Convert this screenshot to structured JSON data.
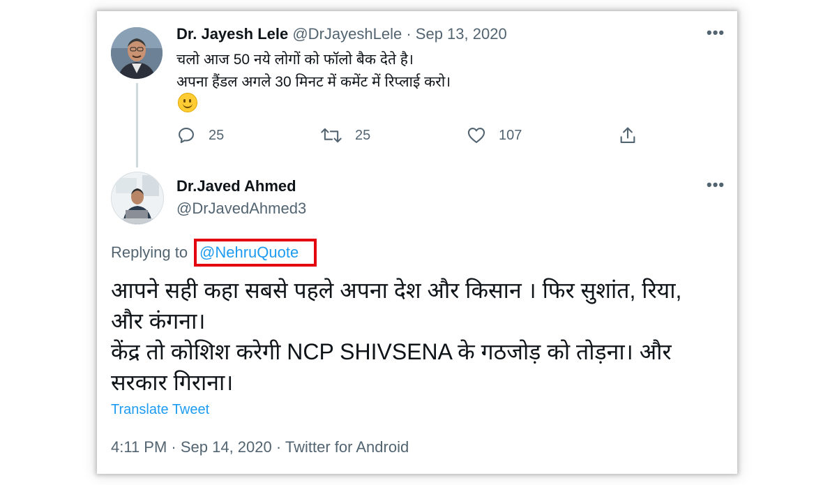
{
  "tweet1": {
    "name": "Dr. Jayesh Lele",
    "handle": "@DrJayeshLele",
    "date": "Sep 13, 2020",
    "lines": [
      "चलो आज 50 नये लोगों को फॉलो बैक देते है।",
      "अपना हैंडल अगले 30 मिनट में कमेंट में रिप्लाई करो।"
    ],
    "emoji": "slightly-smiling-face",
    "more_icon": "more-icon",
    "actions": {
      "reply": {
        "icon": "reply-icon",
        "count": "25"
      },
      "retweet": {
        "icon": "retweet-icon",
        "count": "25"
      },
      "like": {
        "icon": "heart-icon",
        "count": "107"
      },
      "share": {
        "icon": "share-icon"
      }
    }
  },
  "tweet2": {
    "name": "Dr.Javed Ahmed",
    "handle": "@DrJavedAhmed3",
    "replying_prefix": "Replying to ",
    "replying_to": "@NehruQuote",
    "lines": [
      "आपने सही कहा सबसे पहले अपना देश और किसान । फिर सुशांत, रिया,",
      "और कंगना।",
      "केंद्र तो कोशिश करेगी NCP SHIVSENA के गठजोड़ को तोड़ना। और",
      "सरकार गिराना।"
    ],
    "translate_label": "Translate Tweet",
    "footer": "4:11 PM · Sep 14, 2020 · Twitter for Android"
  },
  "colors": {
    "text": "#0f1419",
    "secondary": "#536471",
    "link": "#1d9bf0",
    "highlight": "#e3000f"
  }
}
